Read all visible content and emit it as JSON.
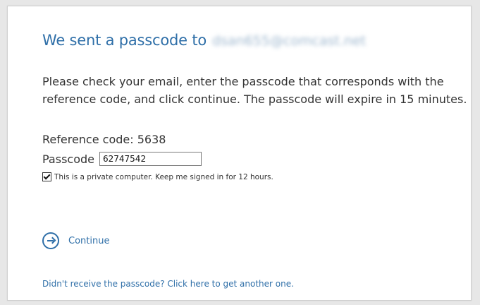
{
  "heading": {
    "prefix": "We sent a passcode to",
    "email": "dsan655@comcast.net"
  },
  "instructions": "Please check your email, enter the passcode that corresponds with the reference code, and click continue. The passcode will expire in 15 minutes.",
  "reference": {
    "text": "Reference code: 5638"
  },
  "passcode": {
    "label": "Passcode",
    "value": "62747542"
  },
  "remember": {
    "label": "This is a private computer. Keep me signed in for 12 hours.",
    "checked": true
  },
  "continue": {
    "label": "Continue"
  },
  "resend_link": "Didn't receive the passcode? Click here to get another one.",
  "colors": {
    "accent": "#2f6fa8",
    "text": "#333333",
    "background": "#ffffff"
  }
}
